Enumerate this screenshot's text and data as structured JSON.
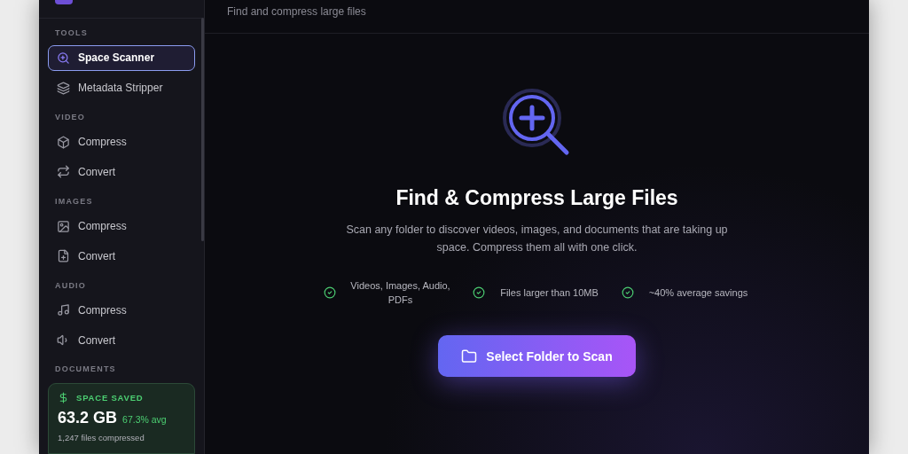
{
  "header": {
    "subtitle": "Find and compress large files"
  },
  "sidebar": {
    "sections": [
      {
        "label": "TOOLS",
        "items": [
          {
            "label": "Space Scanner",
            "kind": "scan",
            "selected": true
          },
          {
            "label": "Metadata Stripper",
            "kind": "layers",
            "selected": false
          }
        ]
      },
      {
        "label": "VIDEO",
        "items": [
          {
            "label": "Compress",
            "kind": "box",
            "selected": false
          },
          {
            "label": "Convert",
            "kind": "repeat",
            "selected": false
          }
        ]
      },
      {
        "label": "IMAGES",
        "items": [
          {
            "label": "Compress",
            "kind": "image",
            "selected": false
          },
          {
            "label": "Convert",
            "kind": "file",
            "selected": false
          }
        ]
      },
      {
        "label": "AUDIO",
        "items": [
          {
            "label": "Compress",
            "kind": "music",
            "selected": false
          },
          {
            "label": "Convert",
            "kind": "speaker",
            "selected": false
          }
        ]
      },
      {
        "label": "DOCUMENTS"
      }
    ],
    "saved_card": {
      "title": "SPACE SAVED",
      "amount": "63.2 GB",
      "average": "67.3% avg",
      "files": "1,247 files compressed"
    }
  },
  "hero": {
    "title": "Find & Compress Large Files",
    "description": "Scan any folder to discover videos, images, and documents that are taking up space. Compress them all with one click.",
    "features": [
      "Videos, Images, Audio, PDFs",
      "Files larger than 10MB",
      "~40% average savings"
    ],
    "button": "Select Folder to Scan"
  }
}
